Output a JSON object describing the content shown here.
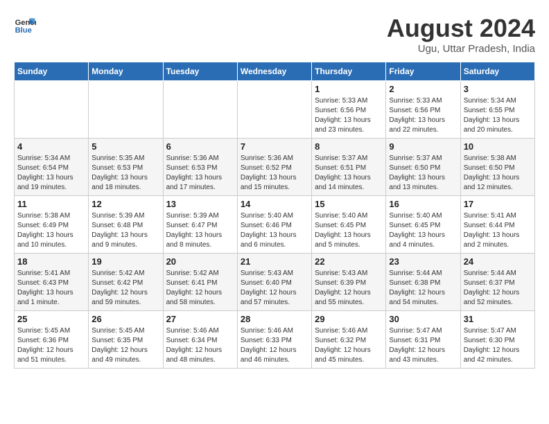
{
  "logo": {
    "line1": "General",
    "line2": "Blue"
  },
  "title": "August 2024",
  "location": "Ugu, Uttar Pradesh, India",
  "weekdays": [
    "Sunday",
    "Monday",
    "Tuesday",
    "Wednesday",
    "Thursday",
    "Friday",
    "Saturday"
  ],
  "weeks": [
    [
      {
        "day": "",
        "info": ""
      },
      {
        "day": "",
        "info": ""
      },
      {
        "day": "",
        "info": ""
      },
      {
        "day": "",
        "info": ""
      },
      {
        "day": "1",
        "info": "Sunrise: 5:33 AM\nSunset: 6:56 PM\nDaylight: 13 hours\nand 23 minutes."
      },
      {
        "day": "2",
        "info": "Sunrise: 5:33 AM\nSunset: 6:56 PM\nDaylight: 13 hours\nand 22 minutes."
      },
      {
        "day": "3",
        "info": "Sunrise: 5:34 AM\nSunset: 6:55 PM\nDaylight: 13 hours\nand 20 minutes."
      }
    ],
    [
      {
        "day": "4",
        "info": "Sunrise: 5:34 AM\nSunset: 6:54 PM\nDaylight: 13 hours\nand 19 minutes."
      },
      {
        "day": "5",
        "info": "Sunrise: 5:35 AM\nSunset: 6:53 PM\nDaylight: 13 hours\nand 18 minutes."
      },
      {
        "day": "6",
        "info": "Sunrise: 5:36 AM\nSunset: 6:53 PM\nDaylight: 13 hours\nand 17 minutes."
      },
      {
        "day": "7",
        "info": "Sunrise: 5:36 AM\nSunset: 6:52 PM\nDaylight: 13 hours\nand 15 minutes."
      },
      {
        "day": "8",
        "info": "Sunrise: 5:37 AM\nSunset: 6:51 PM\nDaylight: 13 hours\nand 14 minutes."
      },
      {
        "day": "9",
        "info": "Sunrise: 5:37 AM\nSunset: 6:50 PM\nDaylight: 13 hours\nand 13 minutes."
      },
      {
        "day": "10",
        "info": "Sunrise: 5:38 AM\nSunset: 6:50 PM\nDaylight: 13 hours\nand 12 minutes."
      }
    ],
    [
      {
        "day": "11",
        "info": "Sunrise: 5:38 AM\nSunset: 6:49 PM\nDaylight: 13 hours\nand 10 minutes."
      },
      {
        "day": "12",
        "info": "Sunrise: 5:39 AM\nSunset: 6:48 PM\nDaylight: 13 hours\nand 9 minutes."
      },
      {
        "day": "13",
        "info": "Sunrise: 5:39 AM\nSunset: 6:47 PM\nDaylight: 13 hours\nand 8 minutes."
      },
      {
        "day": "14",
        "info": "Sunrise: 5:40 AM\nSunset: 6:46 PM\nDaylight: 13 hours\nand 6 minutes."
      },
      {
        "day": "15",
        "info": "Sunrise: 5:40 AM\nSunset: 6:45 PM\nDaylight: 13 hours\nand 5 minutes."
      },
      {
        "day": "16",
        "info": "Sunrise: 5:40 AM\nSunset: 6:45 PM\nDaylight: 13 hours\nand 4 minutes."
      },
      {
        "day": "17",
        "info": "Sunrise: 5:41 AM\nSunset: 6:44 PM\nDaylight: 13 hours\nand 2 minutes."
      }
    ],
    [
      {
        "day": "18",
        "info": "Sunrise: 5:41 AM\nSunset: 6:43 PM\nDaylight: 13 hours\nand 1 minute."
      },
      {
        "day": "19",
        "info": "Sunrise: 5:42 AM\nSunset: 6:42 PM\nDaylight: 12 hours\nand 59 minutes."
      },
      {
        "day": "20",
        "info": "Sunrise: 5:42 AM\nSunset: 6:41 PM\nDaylight: 12 hours\nand 58 minutes."
      },
      {
        "day": "21",
        "info": "Sunrise: 5:43 AM\nSunset: 6:40 PM\nDaylight: 12 hours\nand 57 minutes."
      },
      {
        "day": "22",
        "info": "Sunrise: 5:43 AM\nSunset: 6:39 PM\nDaylight: 12 hours\nand 55 minutes."
      },
      {
        "day": "23",
        "info": "Sunrise: 5:44 AM\nSunset: 6:38 PM\nDaylight: 12 hours\nand 54 minutes."
      },
      {
        "day": "24",
        "info": "Sunrise: 5:44 AM\nSunset: 6:37 PM\nDaylight: 12 hours\nand 52 minutes."
      }
    ],
    [
      {
        "day": "25",
        "info": "Sunrise: 5:45 AM\nSunset: 6:36 PM\nDaylight: 12 hours\nand 51 minutes."
      },
      {
        "day": "26",
        "info": "Sunrise: 5:45 AM\nSunset: 6:35 PM\nDaylight: 12 hours\nand 49 minutes."
      },
      {
        "day": "27",
        "info": "Sunrise: 5:46 AM\nSunset: 6:34 PM\nDaylight: 12 hours\nand 48 minutes."
      },
      {
        "day": "28",
        "info": "Sunrise: 5:46 AM\nSunset: 6:33 PM\nDaylight: 12 hours\nand 46 minutes."
      },
      {
        "day": "29",
        "info": "Sunrise: 5:46 AM\nSunset: 6:32 PM\nDaylight: 12 hours\nand 45 minutes."
      },
      {
        "day": "30",
        "info": "Sunrise: 5:47 AM\nSunset: 6:31 PM\nDaylight: 12 hours\nand 43 minutes."
      },
      {
        "day": "31",
        "info": "Sunrise: 5:47 AM\nSunset: 6:30 PM\nDaylight: 12 hours\nand 42 minutes."
      }
    ]
  ]
}
